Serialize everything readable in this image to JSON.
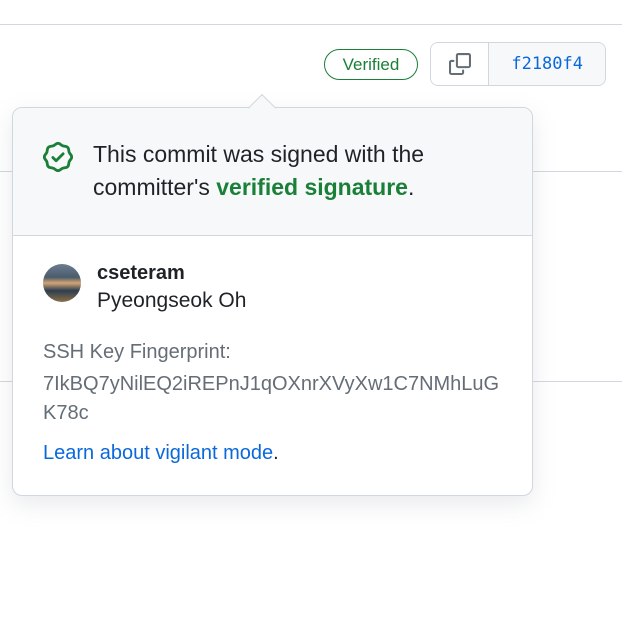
{
  "header": {
    "verified_label": "Verified",
    "commit_sha": "f2180f4"
  },
  "popover": {
    "signed_text_prefix": "This commit was signed with the committer's ",
    "signed_text_link": "verified signature",
    "signed_text_suffix": ".",
    "committer": {
      "username": "cseteram",
      "realname": "Pyeongseok Oh"
    },
    "fingerprint": {
      "label": "SSH Key Fingerprint:",
      "value": "7IkBQ7yNilEQ2iREPnJ1qOXnrXVyXw1C7NMhLuGK78c"
    },
    "vigilant": {
      "link_text": "Learn about vigilant mode",
      "suffix": "."
    }
  }
}
